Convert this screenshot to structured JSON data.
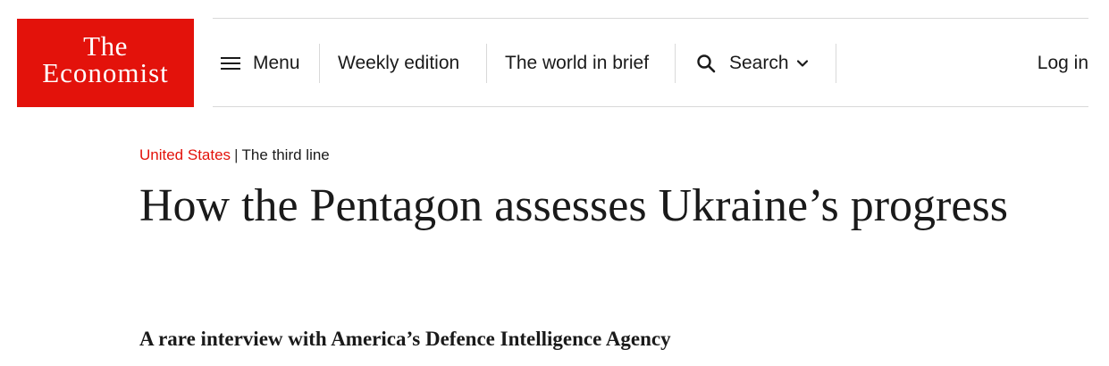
{
  "brand": {
    "line1": "The",
    "line2": "Economist",
    "color": "#e3120b"
  },
  "nav": {
    "menu_label": "Menu",
    "menu_icon": "hamburger-icon",
    "weekly_edition": "Weekly edition",
    "world_in_brief": "The world in brief",
    "search_label": "Search",
    "search_icon": "search-icon",
    "dropdown_icon": "chevron-down-icon",
    "login": "Log in"
  },
  "article": {
    "section": "United States",
    "separator": "|",
    "fly_title": "The third line",
    "headline": "How the Pentagon assesses Ukraine’s progress",
    "subheadline": "A rare interview with America’s Defence Intelligence Agency"
  }
}
